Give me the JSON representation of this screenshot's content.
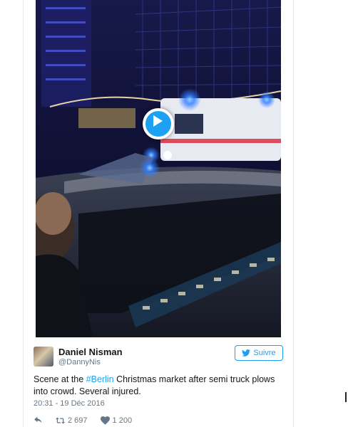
{
  "tweet": {
    "display_name": "Daniel Nisman",
    "handle": "@DannyNis",
    "follow_label": "Suivre",
    "text_before": "Scene at the ",
    "hashtag": "#Berlin",
    "text_after": " Christmas market after semi truck plows into crowd. Several injured.",
    "timestamp": "20:31 - 19 Déc 2016",
    "retweet_count": "2 697",
    "like_count": "1 200"
  },
  "video": {
    "play_icon": "play-icon",
    "accent": "#1da1f2"
  },
  "colors": {
    "accent": "#1da1f2",
    "text": "#14171a",
    "muted": "#657786"
  }
}
